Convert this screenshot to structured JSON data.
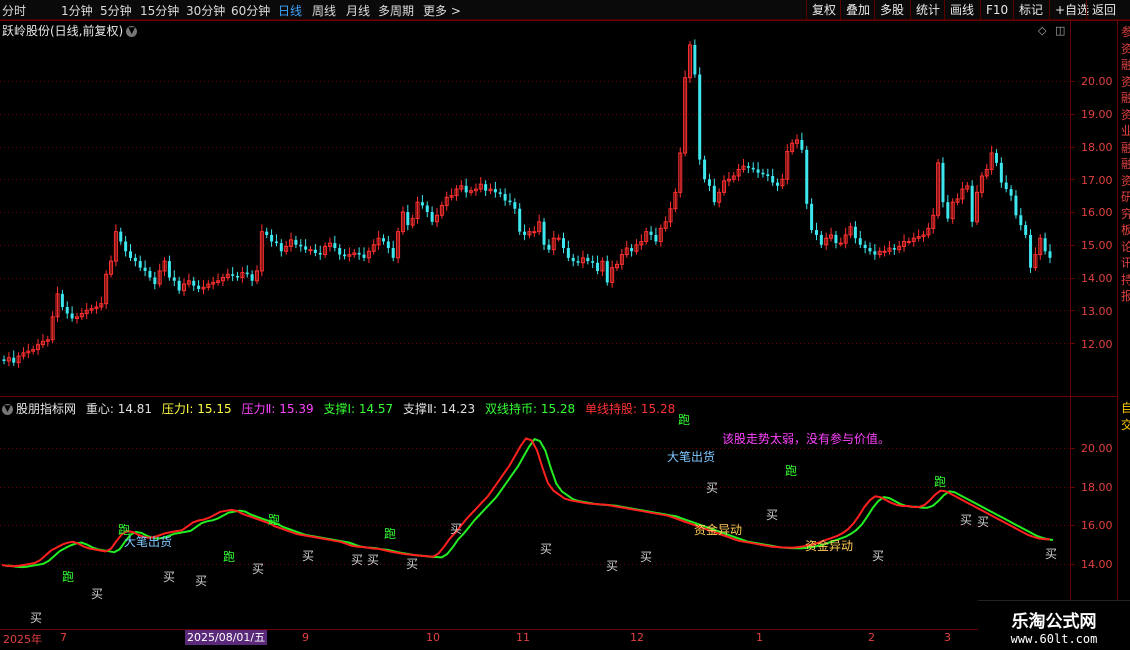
{
  "toolbar": {
    "periods": [
      "分时",
      "1分钟",
      "5分钟",
      "15分钟",
      "30分钟",
      "60分钟",
      "日线",
      "周线",
      "月线",
      "多周期",
      "更多 >"
    ],
    "active_period": "日线",
    "right_buttons": [
      "复权",
      "叠加",
      "多股",
      "统计",
      "画线",
      "F10",
      "标记",
      "+自选",
      "返回"
    ]
  },
  "main_chart": {
    "title": "跃岭股份(日线,前复权)",
    "price_labels": [
      "20.00",
      "19.00",
      "18.00",
      "17.00",
      "16.00",
      "15.00",
      "14.00",
      "13.00",
      "12.00"
    ]
  },
  "indicator": {
    "name": "股朋指标网",
    "values": [
      {
        "label": "重心: 14.81",
        "color": "#e0e0e0"
      },
      {
        "label": "压力Ⅰ: 15.15",
        "color": "#ffff44"
      },
      {
        "label": "压力Ⅱ: 15.39",
        "color": "#ff44ff"
      },
      {
        "label": "支撑Ⅰ: 14.57",
        "color": "#33ff33"
      },
      {
        "label": "支撑Ⅱ: 14.23",
        "color": "#e0e0e0"
      },
      {
        "label": "双线持币: 15.28",
        "color": "#33ff33"
      },
      {
        "label": "单线持股: 15.28",
        "color": "#ff3333"
      }
    ],
    "price_labels": [
      "20.00",
      "18.00",
      "16.00",
      "14.00"
    ],
    "note": "该股走势太弱，没有参与价值。",
    "signal_text": {
      "run": "跑",
      "buy": "买",
      "big": "大笔出货",
      "fund": "资金异动"
    }
  },
  "date_axis": {
    "labels": [
      "2025年",
      "7",
      "8",
      "9",
      "10",
      "11",
      "12",
      "1",
      "2",
      "3"
    ],
    "cursor_date": "2025/08/01/五"
  },
  "side_panel": {
    "upper_text": "参资融资融资业融融资研究板论讯持报",
    "lower_text": "自交"
  },
  "watermark": {
    "main": "乐淘公式网",
    "url": "www.60lt.com"
  },
  "colors": {
    "up": "#ff3030",
    "down": "#3ee6ee",
    "line_red": "#ff2020",
    "line_green": "#22ee22",
    "grid": "#6a0000",
    "axis_label": "#e04040"
  },
  "chart_data": {
    "type": "candlestick",
    "open": [
      11.5,
      11.45,
      11.55,
      11.4,
      11.6,
      11.7,
      11.75,
      11.8,
      11.95,
      12.05,
      12.1,
      12.8,
      13.5,
      13.1,
      12.9,
      12.75,
      12.8,
      12.9,
      13.0,
      13.05,
      13.1,
      13.2,
      14.1,
      14.5,
      15.4,
      15.1,
      14.8,
      14.6,
      14.5,
      14.3,
      14.2,
      14.0,
      13.8,
      14.2,
      14.5,
      14.0,
      13.9,
      13.6,
      13.8,
      13.9,
      13.75,
      13.65,
      13.7,
      13.8,
      13.85,
      13.9,
      14.0,
      14.1,
      14.05,
      14.0,
      14.15,
      14.1,
      13.9,
      14.2,
      15.4,
      15.3,
      15.1,
      15.05,
      14.8,
      14.95,
      15.15,
      15.0,
      14.95,
      14.85,
      14.85,
      14.75,
      14.7,
      14.95,
      15.05,
      14.9,
      14.7,
      14.65,
      14.7,
      14.75,
      14.7,
      14.6,
      14.8,
      15.0,
      15.2,
      15.1,
      14.9,
      14.6,
      15.4,
      16.0,
      15.6,
      15.8,
      16.3,
      16.2,
      16.0,
      15.7,
      15.9,
      16.2,
      16.45,
      16.5,
      16.7,
      16.8,
      16.6,
      16.65,
      16.7,
      16.85,
      16.65,
      16.7,
      16.6,
      16.55,
      16.35,
      16.3,
      16.1,
      15.4,
      15.3,
      15.4,
      15.4,
      15.7,
      15.0,
      14.85,
      15.2,
      15.2,
      14.9,
      14.6,
      14.5,
      14.45,
      14.6,
      14.5,
      14.45,
      14.2,
      14.5,
      13.85,
      14.3,
      14.4,
      14.7,
      14.9,
      14.8,
      15.0,
      15.1,
      15.4,
      15.3,
      15.1,
      15.5,
      15.7,
      16.1,
      16.6,
      17.8,
      20.1,
      21.1,
      20.2,
      17.6,
      17.0,
      16.8,
      16.3,
      16.6,
      16.95,
      17.0,
      17.1,
      17.3,
      17.4,
      17.35,
      17.3,
      17.2,
      17.15,
      17.1,
      16.9,
      16.8,
      17.0,
      17.85,
      18.1,
      18.2,
      17.9,
      16.25,
      15.45,
      15.3,
      15.0,
      15.2,
      15.3,
      15.05,
      15.05,
      15.3,
      15.55,
      15.2,
      15.0,
      14.9,
      14.8,
      14.7,
      14.8,
      14.8,
      14.9,
      14.85,
      14.95,
      15.1,
      15.1,
      15.2,
      15.25,
      15.3,
      15.5,
      15.9,
      17.5,
      16.3,
      15.8,
      16.3,
      16.4,
      16.7,
      16.8,
      15.7,
      16.6,
      17.1,
      17.3,
      17.8,
      17.5,
      16.9,
      16.7,
      16.5,
      15.9,
      15.6,
      15.3,
      14.3,
      14.7,
      15.2,
      14.8
    ],
    "close": [
      11.45,
      11.55,
      11.4,
      11.6,
      11.7,
      11.75,
      11.8,
      11.95,
      12.05,
      12.1,
      12.8,
      13.5,
      13.1,
      12.9,
      12.75,
      12.8,
      12.9,
      13.0,
      13.05,
      13.1,
      13.2,
      14.1,
      14.5,
      15.4,
      15.1,
      14.8,
      14.6,
      14.5,
      14.3,
      14.2,
      14.0,
      13.8,
      14.2,
      14.5,
      14.0,
      13.9,
      13.6,
      13.8,
      13.9,
      13.75,
      13.65,
      13.7,
      13.8,
      13.85,
      13.9,
      14.0,
      14.1,
      14.05,
      14.0,
      14.15,
      14.1,
      13.9,
      14.2,
      15.4,
      15.3,
      15.1,
      15.05,
      14.8,
      14.95,
      15.15,
      15.0,
      14.95,
      14.85,
      14.85,
      14.75,
      14.7,
      14.95,
      15.05,
      14.9,
      14.7,
      14.65,
      14.7,
      14.75,
      14.7,
      14.6,
      14.8,
      15.0,
      15.2,
      15.1,
      14.9,
      14.6,
      15.4,
      16.0,
      15.6,
      15.8,
      16.3,
      16.2,
      16.0,
      15.7,
      15.9,
      16.2,
      16.45,
      16.5,
      16.7,
      16.8,
      16.6,
      16.65,
      16.7,
      16.85,
      16.65,
      16.7,
      16.6,
      16.55,
      16.35,
      16.3,
      16.1,
      15.4,
      15.3,
      15.4,
      15.4,
      15.7,
      15.0,
      14.85,
      15.2,
      15.2,
      14.9,
      14.6,
      14.5,
      14.45,
      14.6,
      14.5,
      14.45,
      14.2,
      14.5,
      13.85,
      14.3,
      14.4,
      14.7,
      14.9,
      14.8,
      15.0,
      15.1,
      15.4,
      15.3,
      15.1,
      15.5,
      15.7,
      16.1,
      16.6,
      17.8,
      20.1,
      21.1,
      20.2,
      17.6,
      17.0,
      16.8,
      16.3,
      16.6,
      16.95,
      17.0,
      17.1,
      17.3,
      17.4,
      17.35,
      17.3,
      17.2,
      17.15,
      17.1,
      16.9,
      16.8,
      17.0,
      17.85,
      18.1,
      18.2,
      17.9,
      16.25,
      15.45,
      15.3,
      15.0,
      15.2,
      15.3,
      15.05,
      15.05,
      15.3,
      15.55,
      15.2,
      15.0,
      14.9,
      14.8,
      14.7,
      14.8,
      14.8,
      14.9,
      14.85,
      14.95,
      15.1,
      15.1,
      15.2,
      15.25,
      15.3,
      15.5,
      15.9,
      17.5,
      16.3,
      15.8,
      16.3,
      16.4,
      16.7,
      16.8,
      15.7,
      16.6,
      17.1,
      17.3,
      17.8,
      17.5,
      16.9,
      16.7,
      16.5,
      15.9,
      15.6,
      15.3,
      14.3,
      14.7,
      15.2,
      14.8,
      14.6
    ],
    "line_red": [
      13.95,
      13.9,
      13.88,
      13.9,
      13.95,
      14.0,
      14.05,
      14.2,
      14.45,
      14.7,
      14.85,
      15.0,
      15.1,
      15.15,
      15.05,
      14.9,
      14.8,
      14.75,
      14.7,
      14.65,
      14.8,
      15.2,
      15.55,
      15.7,
      15.65,
      15.5,
      15.4,
      15.35,
      15.4,
      15.5,
      15.6,
      15.65,
      15.7,
      15.75,
      15.95,
      16.15,
      16.25,
      16.3,
      16.4,
      16.55,
      16.7,
      16.75,
      16.8,
      16.75,
      16.6,
      16.5,
      16.4,
      16.3,
      16.2,
      16.1,
      15.95,
      15.85,
      15.75,
      15.65,
      15.55,
      15.5,
      15.45,
      15.4,
      15.35,
      15.3,
      15.25,
      15.2,
      15.15,
      15.05,
      14.95,
      14.9,
      14.88,
      14.85,
      14.8,
      14.78,
      14.72,
      14.65,
      14.6,
      14.55,
      14.5,
      14.48,
      14.45,
      14.42,
      14.4,
      14.38,
      14.55,
      14.9,
      15.3,
      15.6,
      15.95,
      16.3,
      16.6,
      16.9,
      17.2,
      17.5,
      17.9,
      18.3,
      18.7,
      19.1,
      19.6,
      20.1,
      20.5,
      20.4,
      19.9,
      19.0,
      18.2,
      17.8,
      17.6,
      17.4,
      17.3,
      17.25,
      17.2,
      17.15,
      17.12,
      17.1,
      17.08,
      17.05,
      17.0,
      16.95,
      16.9,
      16.85,
      16.8,
      16.75,
      16.7,
      16.65,
      16.6,
      16.55,
      16.5,
      16.4,
      16.3,
      16.2,
      16.1,
      16.0,
      15.9,
      15.8,
      15.7,
      15.6,
      15.5,
      15.4,
      15.3,
      15.2,
      15.15,
      15.1,
      15.05,
      15.0,
      14.95,
      14.9,
      14.88,
      14.86,
      14.85,
      14.85,
      14.88,
      14.92,
      14.98,
      15.05,
      15.15,
      15.25,
      15.35,
      15.45,
      15.6,
      15.8,
      16.1,
      16.5,
      16.95,
      17.3,
      17.5,
      17.45,
      17.3,
      17.15,
      17.05,
      17.0,
      17.0,
      16.95,
      16.95,
      17.05,
      17.3,
      17.6,
      17.8,
      17.75,
      17.6,
      17.45,
      17.3,
      17.15,
      17.0,
      16.85,
      16.7,
      16.55,
      16.4,
      16.25,
      16.1,
      15.95,
      15.8,
      15.65,
      15.5,
      15.4,
      15.32,
      15.28,
      15.28
    ]
  }
}
